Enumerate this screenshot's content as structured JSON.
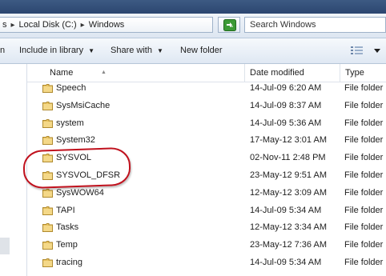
{
  "address": {
    "crumb_prev": "s",
    "crumb_drive": "Local Disk (C:)",
    "crumb_folder": "Windows",
    "search_placeholder": "Search Windows"
  },
  "toolbar": {
    "open_partial": "n",
    "include_label": "Include in library",
    "share_label": "Share with",
    "new_folder_label": "New folder"
  },
  "columns": {
    "name": "Name",
    "date": "Date modified",
    "type": "Type"
  },
  "rows": [
    {
      "name": "Speech",
      "date": "14-Jul-09 6:20 AM",
      "type": "File folder"
    },
    {
      "name": "SysMsiCache",
      "date": "14-Jul-09 8:37 AM",
      "type": "File folder"
    },
    {
      "name": "system",
      "date": "14-Jul-09 5:36 AM",
      "type": "File folder"
    },
    {
      "name": "System32",
      "date": "17-May-12 3:01 AM",
      "type": "File folder"
    },
    {
      "name": "SYSVOL",
      "date": "02-Nov-11 2:48 PM",
      "type": "File folder"
    },
    {
      "name": "SYSVOL_DFSR",
      "date": "23-May-12 9:51 AM",
      "type": "File folder"
    },
    {
      "name": "SysWOW64",
      "date": "12-May-12 3:09 AM",
      "type": "File folder"
    },
    {
      "name": "TAPI",
      "date": "14-Jul-09 5:34 AM",
      "type": "File folder"
    },
    {
      "name": "Tasks",
      "date": "12-May-12 3:34 AM",
      "type": "File folder"
    },
    {
      "name": "Temp",
      "date": "23-May-12 7:36 AM",
      "type": "File folder"
    },
    {
      "name": "tracing",
      "date": "14-Jul-09 5:34 AM",
      "type": "File folder"
    }
  ],
  "colors": {
    "titlebar": "#2c4670",
    "highlight_ellipse": "#c0111d",
    "folder": "#e9c462"
  },
  "icons": {
    "refresh": "refresh-icon",
    "folder": "folder-icon",
    "views": "view-details-icon"
  }
}
